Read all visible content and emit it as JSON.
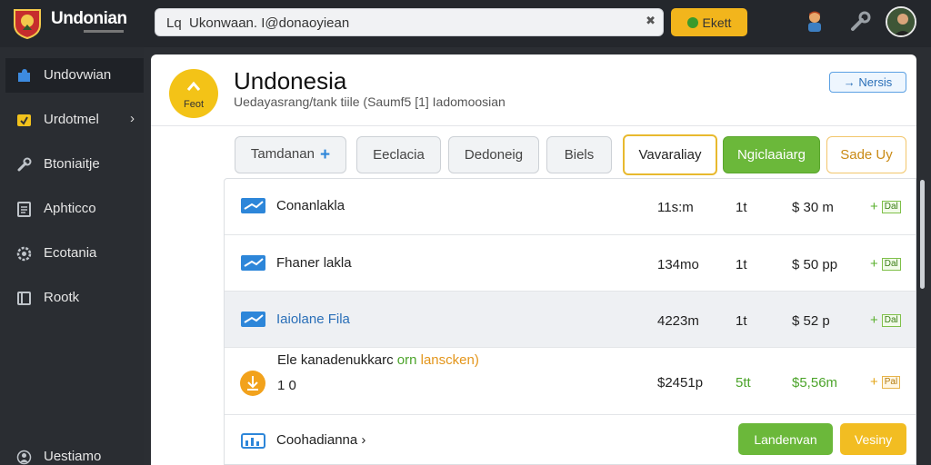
{
  "app": {
    "brand": "Undonian"
  },
  "search": {
    "value": "Lq  Ukonwaan. I@donaoyiean"
  },
  "topbar": {
    "action_label": "Ekett"
  },
  "sidebar": {
    "items": [
      {
        "label": "Undovwian",
        "icon": "puzzle-icon"
      },
      {
        "label": "Urdotmel",
        "icon": "folder-icon"
      },
      {
        "label": "Btoniaitje",
        "icon": "tools-icon"
      },
      {
        "label": "Aphticco",
        "icon": "document-icon"
      },
      {
        "label": "Ecotania",
        "icon": "gear-icon"
      },
      {
        "label": "Rootk",
        "icon": "book-icon"
      },
      {
        "label": "Uestiamo",
        "icon": "user-icon"
      }
    ]
  },
  "header": {
    "title": "Undonesia",
    "subtitle": "Uedayasrang/tank tiile (Saumf5 [1] Iadomoosian",
    "badge_caption": "Feot",
    "news_label": "Nersis"
  },
  "tabs": [
    {
      "label": "Tamdanan"
    },
    {
      "label": "Eeclacia"
    },
    {
      "label": "Dedoneig"
    },
    {
      "label": "Biels"
    },
    {
      "label": "Vavaraliay"
    },
    {
      "label": "Ngiclaaiarg"
    },
    {
      "label": "Sade Uy"
    }
  ],
  "rows": [
    {
      "name": "Conanlakla",
      "size": "11s:m",
      "count": "1t",
      "price": "$ 30 m",
      "badge": "Dal"
    },
    {
      "name": "Fhaner lakla",
      "size": "134mo",
      "count": "1t",
      "price": "$ 50 pp",
      "badge": "Dal"
    },
    {
      "name": "Iaiolane Fila",
      "size": "4223m",
      "count": "1t",
      "price": "$ 52 p",
      "badge": "Dal"
    },
    {
      "name": "Ele kanadenukkarc",
      "name_green": "orn",
      "name_orange": "lanscken)",
      "name_line2": "1 0",
      "size": "$2451p",
      "count": "5tt",
      "price": "$5,56m",
      "badge": "Pal"
    },
    {
      "name": "Coohadianna",
      "name_chevron": "›"
    }
  ],
  "footer_buttons": {
    "primary": "Landenvan",
    "secondary": "Vesiny"
  },
  "colors": {
    "accent_yellow": "#f3c317",
    "accent_green": "#6bb83a",
    "accent_blue": "#2d86d9"
  }
}
